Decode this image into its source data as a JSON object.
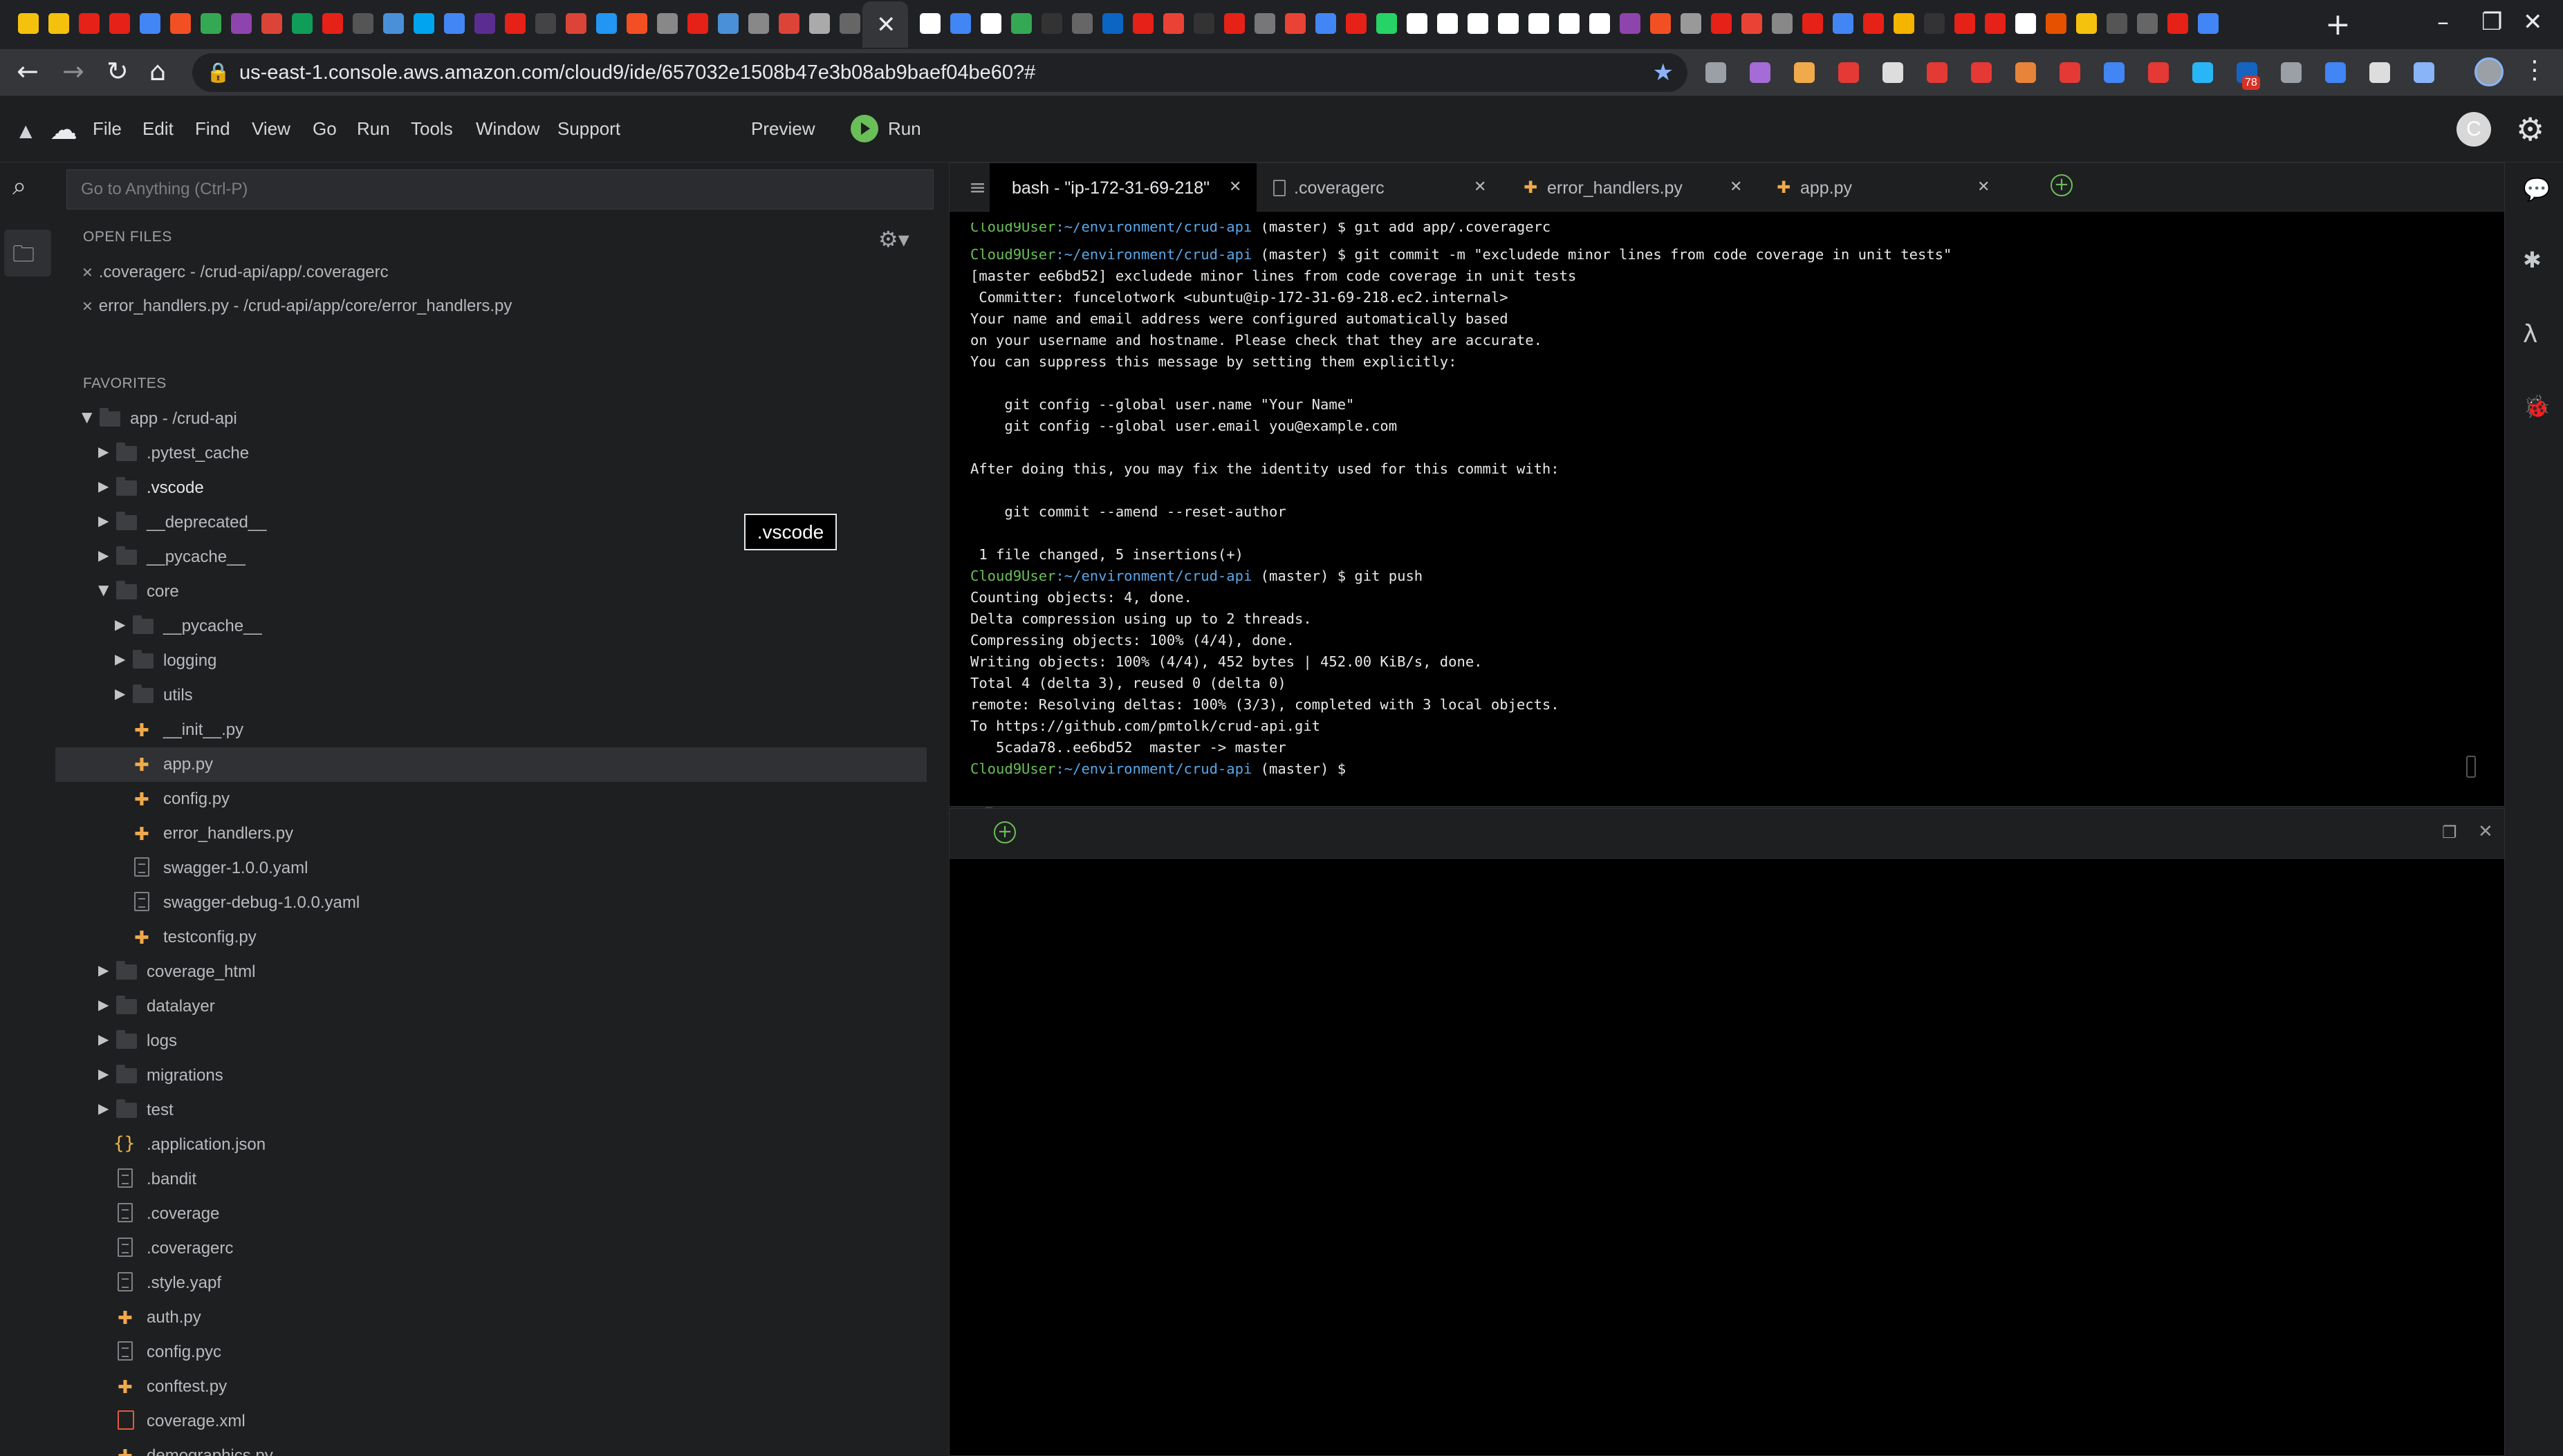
{
  "browser": {
    "url": "us-east-1.console.aws.amazon.com/cloud9/ide/657032e1508b47e3b08ab9baef04be60?#",
    "extension_badge": "78"
  },
  "menubar": {
    "items": [
      "File",
      "Edit",
      "Find",
      "View",
      "Go",
      "Run",
      "Tools",
      "Window",
      "Support"
    ],
    "preview_label": "Preview",
    "run_label": "Run",
    "user_initial": "C"
  },
  "tree": {
    "goto_placeholder": "Go to Anything (Ctrl-P)",
    "open_files_title": "OPEN FILES",
    "open_files": [
      ".coveragerc - /crud-api/app/.coveragerc",
      "error_handlers.py - /crud-api/app/core/error_handlers.py"
    ],
    "favorites_title": "FAVORITES",
    "items": [
      "app - /crud-api",
      ".pytest_cache",
      ".vscode",
      "__deprecated__",
      "__pycache__",
      "core",
      "__pycache__",
      "logging",
      "utils",
      "__init__.py",
      "app.py",
      "config.py",
      "error_handlers.py",
      "swagger-1.0.0.yaml",
      "swagger-debug-1.0.0.yaml",
      "testconfig.py",
      "coverage_html",
      "datalayer",
      "logs",
      "migrations",
      "test",
      ".application.json",
      ".bandit",
      ".coverage",
      ".coveragerc",
      ".style.yapf",
      "auth.py",
      "config.pyc",
      "conftest.py",
      "coverage.xml",
      "demographics.py"
    ],
    "tooltip": ".vscode"
  },
  "editor_tabs": [
    {
      "label": "bash - \"ip-172-31-69-218\""
    },
    {
      "label": ".coveragerc"
    },
    {
      "label": "error_handlers.py"
    },
    {
      "label": "app.py"
    }
  ],
  "terminal": {
    "prompt": "Cloud9User",
    "dir": ":~/environment/crud-api",
    "branch": " (master) $ ",
    "cmd_top": "git add app/.coveragerc",
    "cmd_commit": "git commit -m \"excludede minor lines from code coverage in unit tests\"",
    "out_commit": [
      "[master ee6bd52] excludede minor lines from code coverage in unit tests",
      " Committer: funcelotwork <ubuntu@ip-172-31-69-218.ec2.internal>",
      "Your name and email address were configured automatically based",
      "on your username and hostname. Please check that they are accurate.",
      "You can suppress this message by setting them explicitly:",
      "",
      "    git config --global user.name \"Your Name\"",
      "    git config --global user.email you@example.com",
      "",
      "After doing this, you may fix the identity used for this commit with:",
      "",
      "    git commit --amend --reset-author",
      "",
      " 1 file changed, 5 insertions(+)"
    ],
    "cmd_push": "git push",
    "out_push": [
      "Counting objects: 4, done.",
      "Delta compression using up to 2 threads.",
      "Compressing objects: 100% (4/4), done.",
      "Writing objects: 100% (4/4), 452 bytes | 452.00 KiB/s, done.",
      "Total 4 (delta 3), reused 0 (delta 0)",
      "remote: Resolving deltas: 100% (3/3), completed with 3 local objects.",
      "To https://github.com/pmtolk/crud-api.git",
      "   5cada78..ee6bd52  master -> master"
    ]
  }
}
